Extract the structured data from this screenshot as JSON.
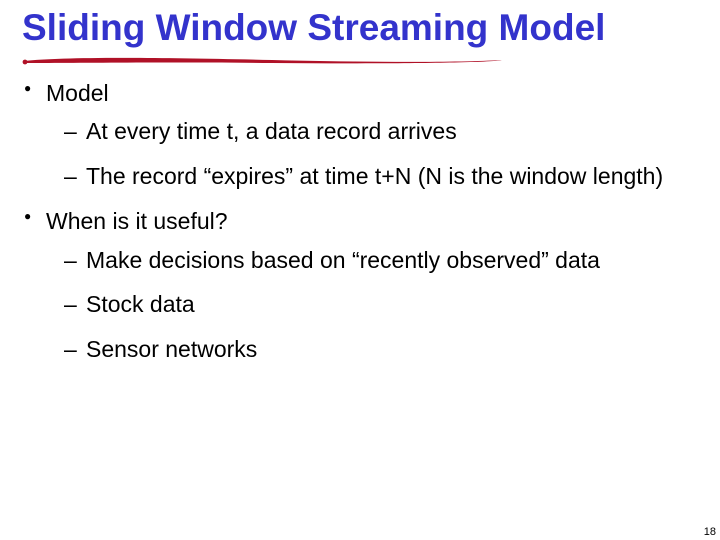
{
  "title": "Sliding Window Streaming Model",
  "accent_color": "#3333cc",
  "underline_color": "#b01127",
  "bullets": [
    {
      "label": "Model",
      "sub": [
        "At every time t, a data record arrives",
        "The record “expires” at time t+N (N is the window length)"
      ]
    },
    {
      "label": "When is it useful?",
      "sub": [
        "Make decisions based on “recently observed” data",
        "Stock data",
        "Sensor networks"
      ]
    }
  ],
  "page_number": "18"
}
